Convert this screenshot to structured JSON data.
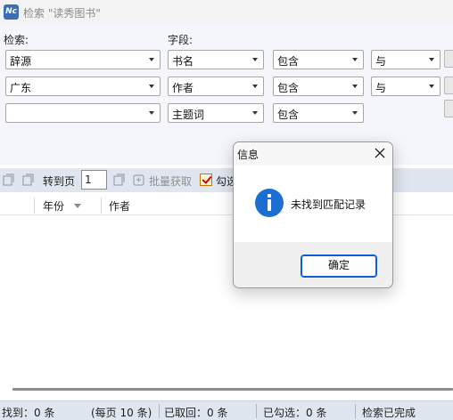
{
  "window": {
    "title": "检索 \"读秀图书\"",
    "app_icon_text": "Nc"
  },
  "search": {
    "label_search": "检索:",
    "label_field": "字段:",
    "rows": [
      {
        "term": "辞源",
        "field": "书名",
        "match": "包含",
        "logic": "与"
      },
      {
        "term": "广东",
        "field": "作者",
        "match": "包含",
        "logic": "与"
      },
      {
        "term": "",
        "field": "主题词",
        "match": "包含"
      }
    ]
  },
  "toolbar": {
    "goto_page_label": "转到页",
    "page_value": "1",
    "batch_fetch_label": "批量获取",
    "check_label": "勾选"
  },
  "table": {
    "columns": [
      "年份",
      "作者"
    ]
  },
  "status": {
    "found": "找到：0 条",
    "per_page": "(每页 10 条)",
    "retrieved": "已取回：0 条",
    "checked": "已勾选：0 条",
    "search_state": "检索已完成"
  },
  "dialog": {
    "title": "信息",
    "message": "未找到匹配记录",
    "ok_label": "确定"
  },
  "colors": {
    "accent": "#1a6fd1",
    "panel_bg": "#f4f6fb",
    "toolbar_bg": "#dfe6ef"
  }
}
